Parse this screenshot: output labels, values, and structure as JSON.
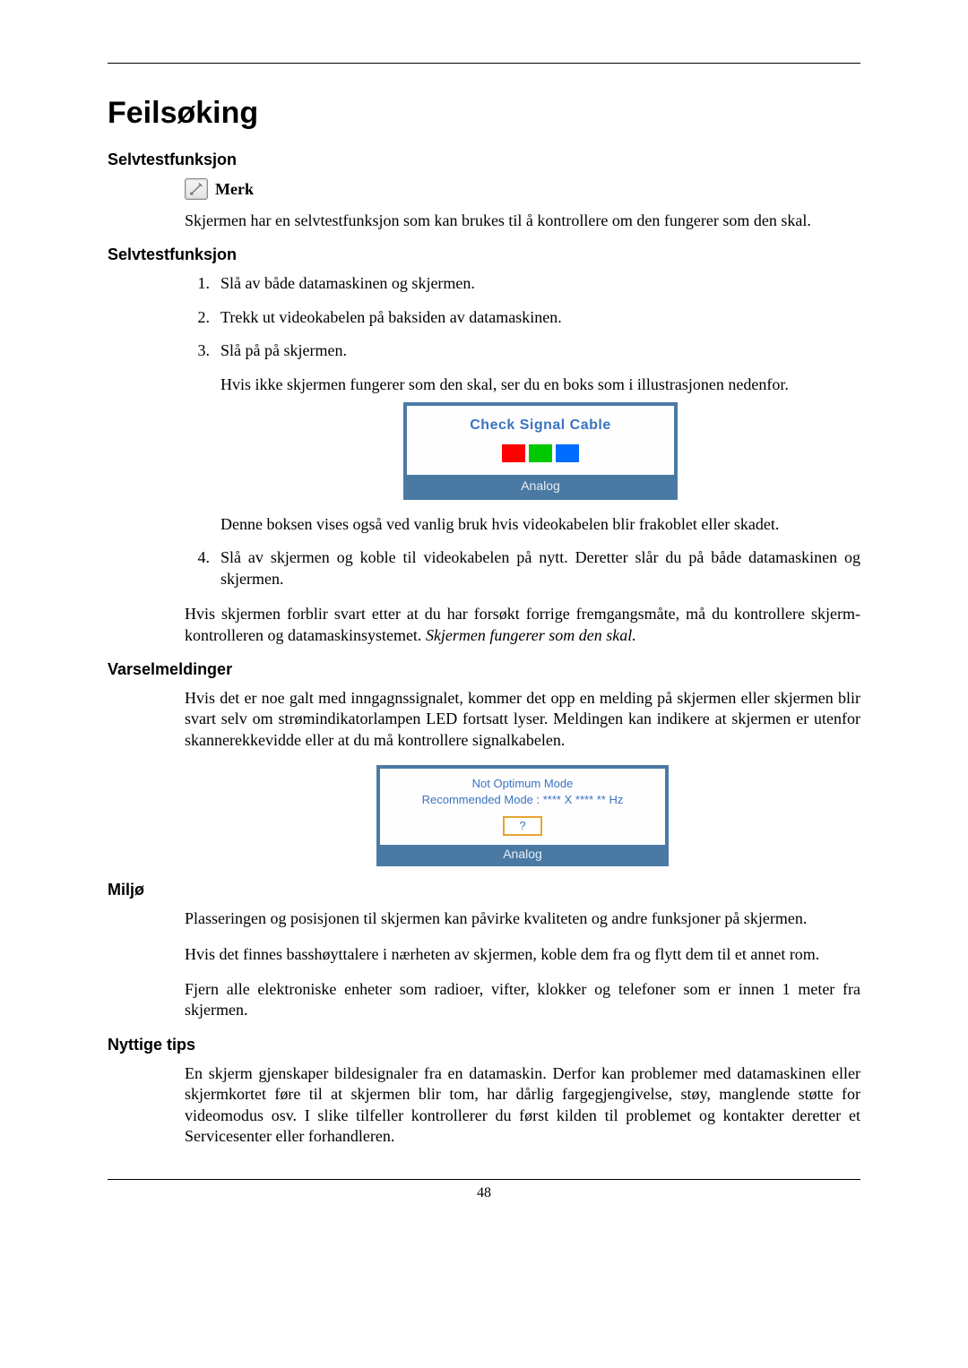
{
  "page_number": "48",
  "title": "Feilsøking",
  "sections": {
    "s1": {
      "heading": "Selvtestfunksjon",
      "note_label": "Merk",
      "text": "Skjermen har en selvtestfunksjon som kan brukes til å kontrollere om den fungerer som den skal."
    },
    "s2": {
      "heading": "Selvtestfunksjon",
      "steps": [
        "Slå av både datamaskinen og skjermen.",
        "Trekk ut videokabelen på baksiden av datamaskinen.",
        "Slå på på skjermen."
      ],
      "after3": "Hvis ikke skjermen fungerer som den skal, ser du en boks som i illustrasjonen nedenfor.",
      "figure": {
        "message": "Check Signal Cable",
        "label": "Analog",
        "flag_colors": [
          "#ff0000",
          "#00c800",
          "#006cff"
        ]
      },
      "after_fig": "Denne boksen vises også ved vanlig bruk hvis videokabelen blir frakoblet eller skadet.",
      "step4": "Slå av skjermen og koble til videokabelen på nytt. Deretter slår du på både datamaskinen og skjermen.",
      "conclusion_plain": "Hvis skjermen forblir svart etter at du har forsøkt forrige fremgangsmåte, må du kontrollere skjerm-kontrolleren og datamaskinsystemet. ",
      "conclusion_italic": "Skjermen fungerer som den skal."
    },
    "s3": {
      "heading": "Varselmeldinger",
      "text": "Hvis det er noe galt med inngagnssignalet, kommer det opp en melding på skjermen eller skjermen blir svart selv om strømindikatorlampen LED fortsatt lyser. Meldingen kan indikere at skjermen er utenfor skannerekkevidde eller at du må kontrollere signalkabelen.",
      "figure": {
        "line1": "Not Optimum Mode",
        "line2": "Recommended Mode :   ****  X  ****    **  Hz",
        "button": "?",
        "label": "Analog"
      }
    },
    "s4": {
      "heading": "Miljø",
      "p1": "Plasseringen og posisjonen til skjermen kan påvirke kvaliteten og andre funksjoner på skjermen.",
      "p2": "Hvis det finnes basshøyttalere i nærheten av skjermen, koble dem fra og flytt dem til et annet rom.",
      "p3": "Fjern alle elektroniske enheter som radioer, vifter, klokker og telefoner som er innen 1 meter fra skjermen."
    },
    "s5": {
      "heading": "Nyttige tips",
      "text": "En skjerm gjenskaper bildesignaler fra en datamaskin. Derfor kan problemer med datamaskinen eller skjermkortet føre til at skjermen blir tom, har dårlig fargegjengivelse, støy, manglende støtte for videomodus osv. I slike tilfeller kontrollerer du først kilden til problemet og kontakter deretter et Servicesenter eller forhandleren."
    }
  }
}
